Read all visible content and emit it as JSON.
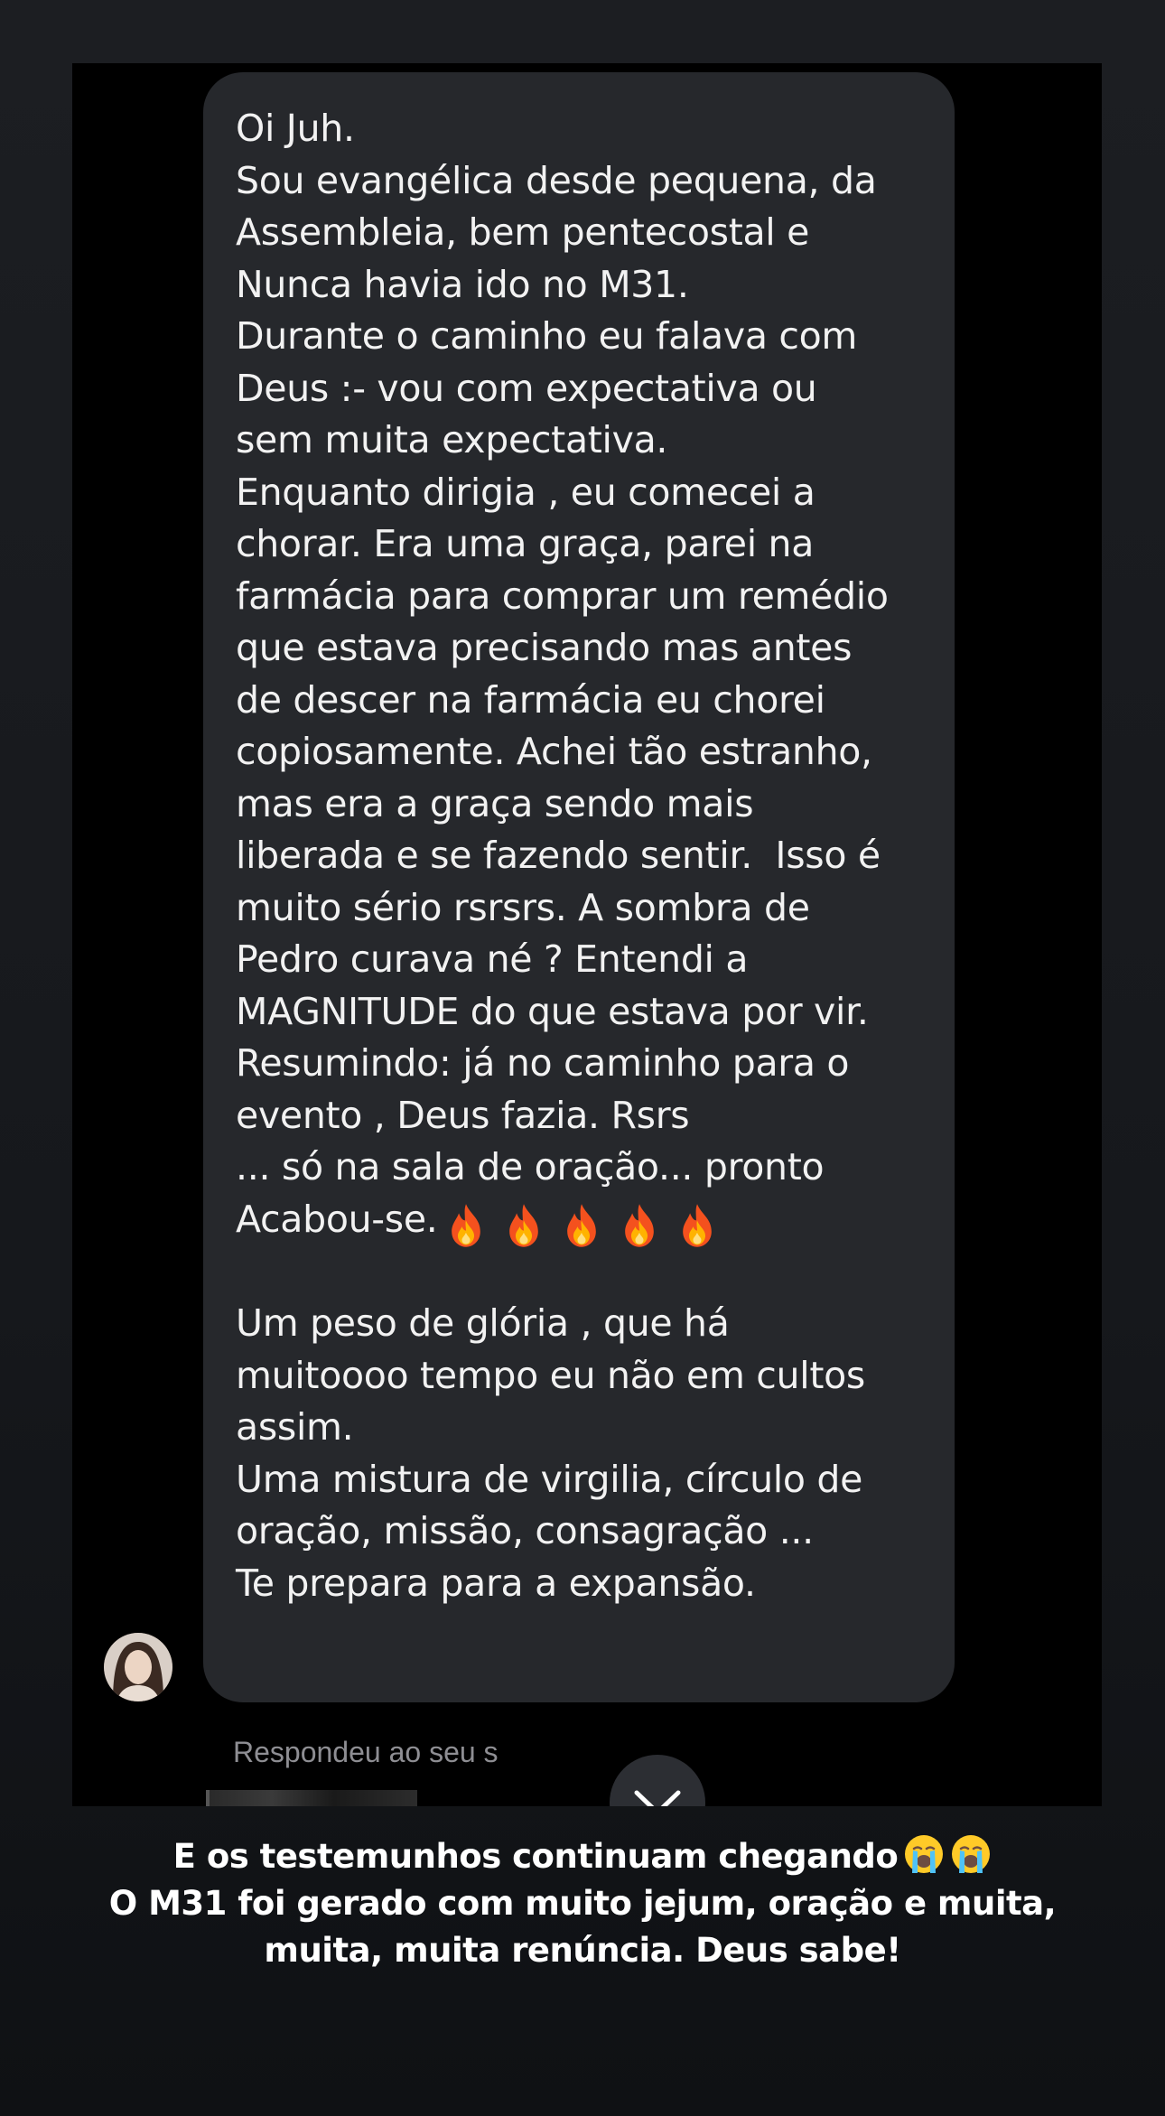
{
  "message": {
    "lines": [
      "Oi Juh.",
      "Sou evangélica desde pequena, da",
      "Assembleia, bem pentecostal e",
      "Nunca havia ido no M31.",
      "Durante o caminho eu falava com",
      "Deus :- vou com expectativa ou",
      "sem muita expectativa.",
      "Enquanto dirigia , eu comecei a",
      "chorar. Era uma graça, parei na",
      "farmácia para comprar um remédio",
      "que estava precisando mas antes",
      "de descer na farmácia eu chorei",
      "copiosamente. Achei tão estranho,",
      "mas era a graça sendo mais",
      "liberada e se fazendo sentir.  Isso é",
      "muito sério rsrsrs. A sombra de",
      "Pedro curava né ? Entendi a",
      "MAGNITUDE do que estava por vir.",
      "Resumindo: já no caminho para o",
      "evento , Deus fazia. Rsrs",
      "... só na sala de oração... pronto",
      "Acabou-se.",
      "",
      "Um peso de glória , que há",
      "muitoooo tempo eu não em cultos",
      "assim.",
      "Uma mistura de virgilia, círculo de",
      "oração, missão, consagração ...",
      "Te prepara para a expansão."
    ],
    "emoji": [
      "fire-icon",
      "fire-icon",
      "fire-icon",
      "fire-icon",
      "fire-icon"
    ]
  },
  "reply": {
    "label": "Respondeu ao seu s"
  },
  "caption": {
    "line1": "E os testemunhos continuam chegando",
    "line1_emoji": [
      "loudly-crying-face-icon",
      "loudly-crying-face-icon"
    ],
    "line2": "O M31 foi gerado com muito jejum, oração e muita,",
    "line3": "muita, muita renúncia. Deus sabe!"
  },
  "colors": {
    "bubble": "#26282c",
    "background": "#17191d",
    "text": "#f2f2f2",
    "secondary_text": "#8e8e93"
  }
}
